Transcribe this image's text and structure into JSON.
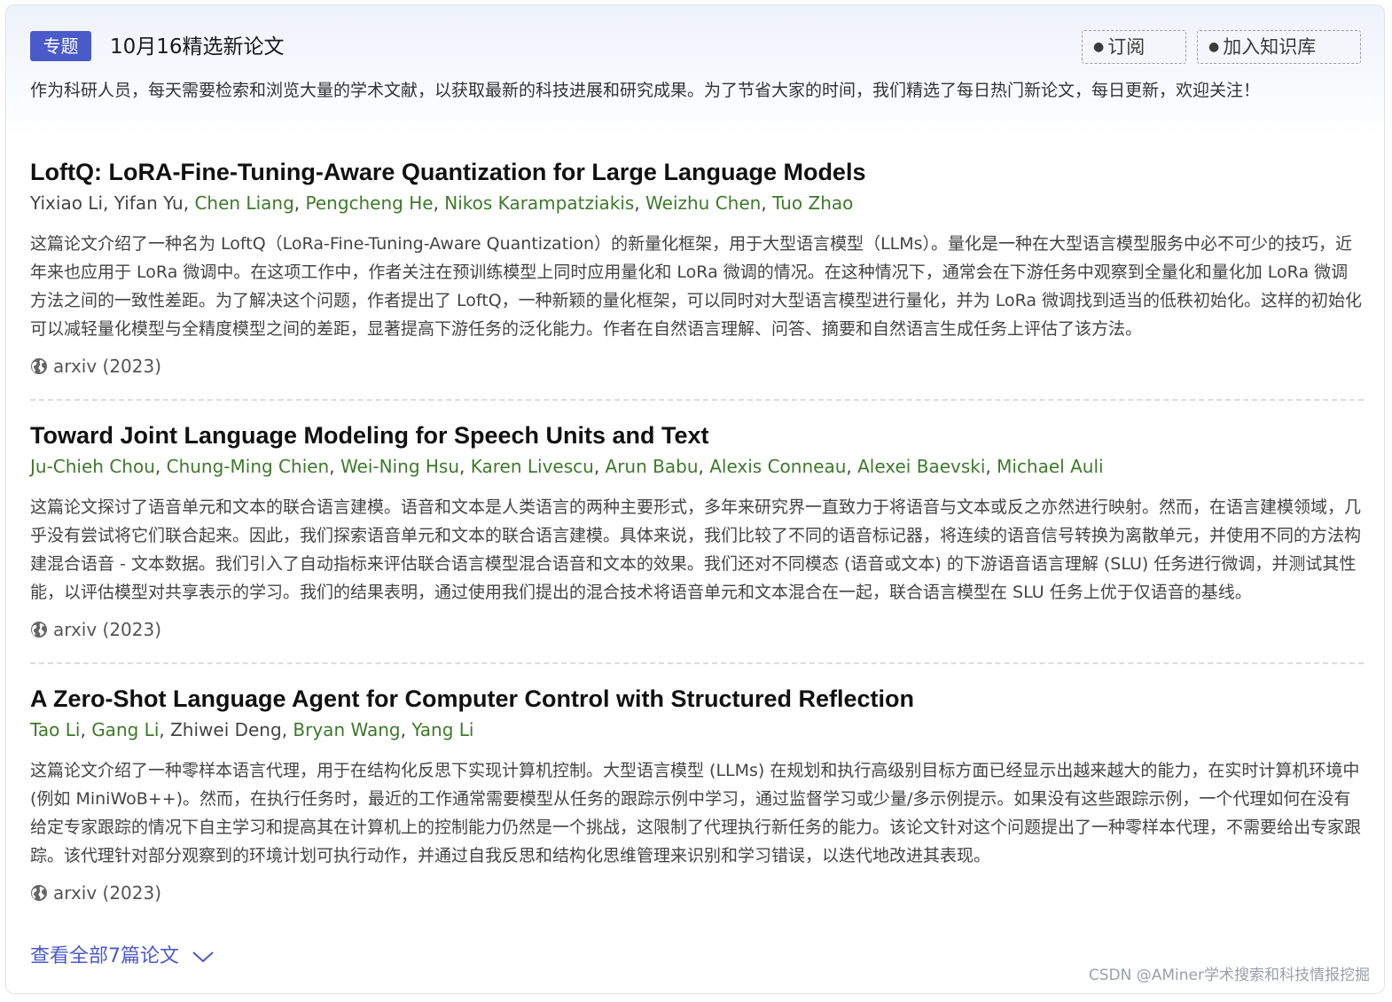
{
  "header": {
    "tag": "专题",
    "title": "10月16精选新论文",
    "subscribe_label": "订阅",
    "kb_label": "加入知识库"
  },
  "intro": "作为科研人员，每天需要检索和浏览大量的学术文献，以获取最新的科技进展和研究成果。为了节省大家的时间，我们精选了每日热门新论文，每日更新，欢迎关注！",
  "papers": [
    {
      "title": "LoftQ: LoRA-Fine-Tuning-Aware Quantization for Large Language Models",
      "authors": [
        {
          "name": "Yixiao Li",
          "linked": false
        },
        {
          "name": "Yifan Yu",
          "linked": false
        },
        {
          "name": "Chen Liang",
          "linked": true
        },
        {
          "name": "Pengcheng He",
          "linked": true
        },
        {
          "name": "Nikos Karampatziakis",
          "linked": true
        },
        {
          "name": "Weizhu Chen",
          "linked": true
        },
        {
          "name": "Tuo Zhao",
          "linked": true
        }
      ],
      "summary": "这篇论文介绍了一种名为 LoftQ（LoRa-Fine-Tuning-Aware Quantization）的新量化框架，用于大型语言模型（LLMs）。量化是一种在大型语言模型服务中必不可少的技巧，近年来也应用于 LoRa 微调中。在这项工作中，作者关注在预训练模型上同时应用量化和 LoRa 微调的情况。在这种情况下，通常会在下游任务中观察到全量化和量化加 LoRa 微调方法之间的一致性差距。为了解决这个问题，作者提出了 LoftQ，一种新颖的量化框架，可以同时对大型语言模型进行量化，并为 LoRa 微调找到适当的低秩初始化。这样的初始化可以减轻量化模型与全精度模型之间的差距，显著提高下游任务的泛化能力。作者在自然语言理解、问答、摘要和自然语言生成任务上评估了该方法。",
      "venue": "arxiv (2023)"
    },
    {
      "title": "Toward Joint Language Modeling for Speech Units and Text",
      "authors": [
        {
          "name": "Ju-Chieh Chou",
          "linked": true
        },
        {
          "name": "Chung-Ming Chien",
          "linked": true
        },
        {
          "name": "Wei-Ning Hsu",
          "linked": true
        },
        {
          "name": "Karen Livescu",
          "linked": true
        },
        {
          "name": "Arun Babu",
          "linked": true
        },
        {
          "name": "Alexis Conneau",
          "linked": true
        },
        {
          "name": "Alexei Baevski",
          "linked": true
        },
        {
          "name": "Michael Auli",
          "linked": true
        }
      ],
      "summary": "这篇论文探讨了语音单元和文本的联合语言建模。语音和文本是人类语言的两种主要形式，多年来研究界一直致力于将语音与文本或反之亦然进行映射。然而，在语言建模领域，几乎没有尝试将它们联合起来。因此，我们探索语音单元和文本的联合语言建模。具体来说，我们比较了不同的语音标记器，将连续的语音信号转换为离散单元，并使用不同的方法构建混合语音 - 文本数据。我们引入了自动指标来评估联合语言模型混合语音和文本的效果。我们还对不同模态 (语音或文本) 的下游语音语言理解 (SLU) 任务进行微调，并测试其性能，以评估模型对共享表示的学习。我们的结果表明，通过使用我们提出的混合技术将语音单元和文本混合在一起，联合语言模型在 SLU 任务上优于仅语音的基线。",
      "venue": "arxiv (2023)"
    },
    {
      "title": "A Zero-Shot Language Agent for Computer Control with Structured Reflection",
      "authors": [
        {
          "name": "Tao Li",
          "linked": true
        },
        {
          "name": "Gang Li",
          "linked": true
        },
        {
          "name": "Zhiwei Deng",
          "linked": false
        },
        {
          "name": "Bryan Wang",
          "linked": true
        },
        {
          "name": "Yang Li",
          "linked": true
        }
      ],
      "summary": "这篇论文介绍了一种零样本语言代理，用于在结构化反思下实现计算机控制。大型语言模型 (LLMs) 在规划和执行高级别目标方面已经显示出越来越大的能力，在实时计算机环境中 (例如 MiniWoB++)。然而，在执行任务时，最近的工作通常需要模型从任务的跟踪示例中学习，通过监督学习或少量/多示例提示。如果没有这些跟踪示例，一个代理如何在没有给定专家跟踪的情况下自主学习和提高其在计算机上的控制能力仍然是一个挑战，这限制了代理执行新任务的能力。该论文针对这个问题提出了一种零样本代理，不需要给出专家跟踪。该代理针对部分观察到的环境计划可执行动作，并通过自我反思和结构化思维管理来识别和学习错误，以迭代地改进其表现。",
      "venue": "arxiv (2023)"
    }
  ],
  "view_all": "查看全部7篇论文",
  "watermark": "CSDN @AMiner学术搜索和科技情报挖掘"
}
